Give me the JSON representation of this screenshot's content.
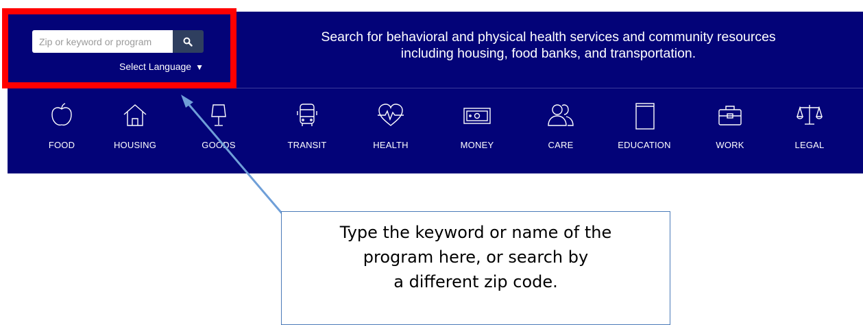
{
  "search": {
    "placeholder": "Zip or keyword or program",
    "button_icon": "search-icon"
  },
  "language": {
    "label": "Select Language",
    "caret": "▼"
  },
  "tagline": {
    "line1": "Search for behavioral and physical health services and community resources",
    "line2": "including housing, food banks, and transportation."
  },
  "categories": [
    {
      "label": "FOOD",
      "icon": "apple-icon"
    },
    {
      "label": "HOUSING",
      "icon": "house-icon"
    },
    {
      "label": "GOODS",
      "icon": "lamp-icon"
    },
    {
      "label": "TRANSIT",
      "icon": "bus-icon"
    },
    {
      "label": "HEALTH",
      "icon": "heart-pulse-icon"
    },
    {
      "label": "MONEY",
      "icon": "banknote-icon"
    },
    {
      "label": "CARE",
      "icon": "people-icon"
    },
    {
      "label": "EDUCATION",
      "icon": "book-icon"
    },
    {
      "label": "WORK",
      "icon": "briefcase-icon"
    },
    {
      "label": "LEGAL",
      "icon": "scales-icon"
    }
  ],
  "callout": {
    "line1": "Type the keyword or name of the",
    "line2": "program here, or search by",
    "line3": "a different zip code."
  },
  "colors": {
    "banner": "#030378",
    "highlight": "#ff0000",
    "arrow": "#6f9fd8",
    "search_button": "#2f3f5f"
  }
}
